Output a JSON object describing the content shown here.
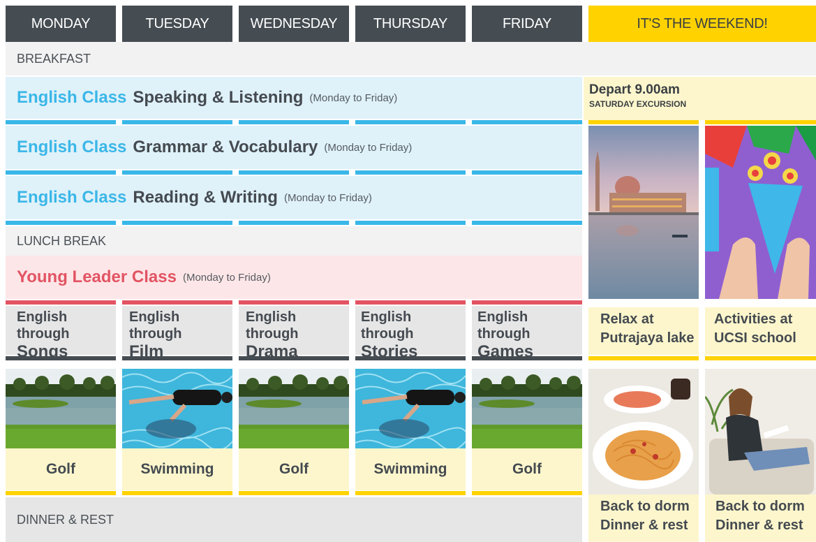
{
  "header": {
    "days": [
      "MONDAY",
      "TUESDAY",
      "WEDNESDAY",
      "THURSDAY",
      "FRIDAY"
    ],
    "weekend": "IT'S THE WEEKEND!"
  },
  "bands": {
    "breakfast": "BREAKFAST",
    "lunch": "LUNCH BREAK",
    "dinner": "DINNER & REST"
  },
  "classes": [
    {
      "prefix": "English Class",
      "title": "Speaking & Listening",
      "note": "(Monday to Friday)"
    },
    {
      "prefix": "English Class",
      "title": "Grammar & Vocabulary",
      "note": "(Monday to Friday)"
    },
    {
      "prefix": "English Class",
      "title": "Reading & Writing",
      "note": "(Monday to Friday)"
    }
  ],
  "leader": {
    "title": "Young Leader Class",
    "note": "(Monday to Friday)"
  },
  "themes": [
    {
      "top": "English through",
      "bottom": "Songs"
    },
    {
      "top": "English through",
      "bottom": "Film"
    },
    {
      "top": "English through",
      "bottom": "Drama"
    },
    {
      "top": "English through",
      "bottom": "Stories"
    },
    {
      "top": "English through",
      "bottom": "Games"
    }
  ],
  "sports": [
    {
      "label": "Golf",
      "image": "golf-course-photo"
    },
    {
      "label": "Swimming",
      "image": "swimmer-photo"
    },
    {
      "label": "Golf",
      "image": "golf-course-photo"
    },
    {
      "label": "Swimming",
      "image": "swimmer-photo"
    },
    {
      "label": "Golf",
      "image": "golf-course-photo"
    }
  ],
  "weekend": {
    "depart": "Depart 9.00am",
    "excursion": "SATURDAY EXCURSION",
    "activities": [
      {
        "line1": "Relax at",
        "line2": "Putrajaya lake",
        "image": "putrajaya-mosque-photo"
      },
      {
        "line1": "Activities at",
        "line2": "UCSI school",
        "image": "paper-craft-photo"
      }
    ],
    "evening": [
      {
        "line1": "Back to dorm",
        "line2": "Dinner & rest",
        "image": "pasta-dinner-photo"
      },
      {
        "line1": "Back to dorm",
        "line2": "Dinner & rest",
        "image": "reading-on-sofa-photo"
      }
    ]
  },
  "colors": {
    "header": "#454c52",
    "weekend": "#ffd200",
    "english_blue": "#3ab7e8",
    "leader_red": "#e25463",
    "cream": "#fdf6cc"
  }
}
